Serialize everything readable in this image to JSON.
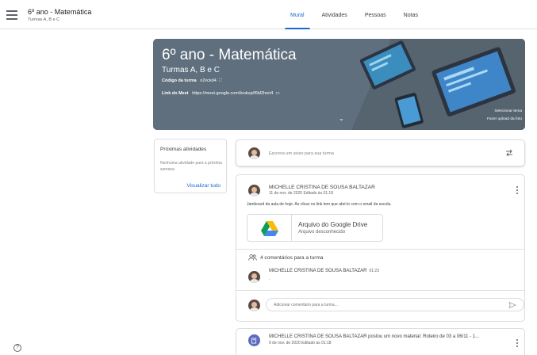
{
  "header": {
    "class_title": "6º ano - Matemática",
    "class_subtitle": "Turmas A, B e C",
    "tabs": [
      {
        "label": "Mural",
        "active": true
      },
      {
        "label": "Atividades",
        "active": false
      },
      {
        "label": "Pessoas",
        "active": false
      },
      {
        "label": "Notas",
        "active": false
      }
    ]
  },
  "banner": {
    "title": "6º ano - Matemática",
    "section": "Turmas A, B e C",
    "code_label": "Código da turma",
    "code_value": "o2vckd4",
    "meet_label": "Link do Meet",
    "meet_value": "https://meet.google.com/lookup/f6bl2hori4",
    "select_theme": "Selecionar tema",
    "upload_photo": "Fazer upload da foto",
    "accent_color": "#607080"
  },
  "upcoming": {
    "title": "Próximas atividades",
    "empty_text": "Nenhuma atividade para a próxima semana",
    "view_all": "Visualizar tudo"
  },
  "announce": {
    "placeholder": "Escreva um aviso para sua turma"
  },
  "post": {
    "author": "MICHELLE CRISTINA DE SOUSA BALTAZAR",
    "date": "11 de nov. de 2020 Editado às 01:18",
    "body": "Jamboard da aula de hoje. Ao clicar no link tem que abri-lo com o email da escola.",
    "attachment": {
      "title": "Arquivo do Google Drive",
      "subtitle": "Arquivo desconhecido"
    },
    "comments_count": "4 comentários para a turma",
    "comment": {
      "author": "MICHELLE CRISTINA DE SOUSA BALTAZAR",
      "time": "01:23",
      "text": "."
    },
    "reply_placeholder": "Adicionar comentário para a turma..."
  },
  "post2": {
    "title": "MICHELLE CRISTINA DE SOUSA BALTAZAR postou um novo material: Roteiro de 03 a 06/11 - 1...",
    "date": "9 de nov. de 2020 Editado às 01:18",
    "icon": "material-icon"
  },
  "help": {
    "icon": "help-icon",
    "glyph": "?"
  }
}
